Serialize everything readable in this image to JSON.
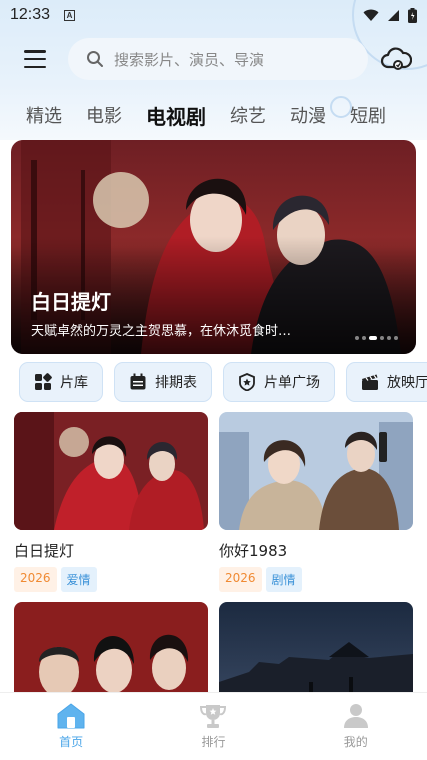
{
  "status": {
    "time": "12:33",
    "notification_glyph": "A"
  },
  "header": {
    "search_placeholder": "搜索影片、演员、导演"
  },
  "tabs": [
    {
      "label": "精选",
      "active": false
    },
    {
      "label": "电影",
      "active": false
    },
    {
      "label": "电视剧",
      "active": true
    },
    {
      "label": "综艺",
      "active": false
    },
    {
      "label": "动漫",
      "active": false
    },
    {
      "label": "短剧",
      "active": false
    }
  ],
  "banner": {
    "title": "白日提灯",
    "description": "天赋卓然的万灵之主贺思慕，在休沐觅食时…",
    "page_count": 6,
    "active_page": 3
  },
  "quick_nav": [
    {
      "label": "片库",
      "icon": "grid-icon"
    },
    {
      "label": "排期表",
      "icon": "calendar-icon"
    },
    {
      "label": "片单广场",
      "icon": "badge-icon"
    },
    {
      "label": "放映厅",
      "icon": "clapperboard-icon"
    }
  ],
  "shows": [
    {
      "title": "白日提灯",
      "year": "2026",
      "genre": "爱情"
    },
    {
      "title": "你好1983",
      "year": "2026",
      "genre": "剧情"
    },
    {
      "title": "",
      "year": "",
      "genre": ""
    },
    {
      "title": "",
      "year": "",
      "genre": ""
    }
  ],
  "bottom_nav": [
    {
      "label": "首页",
      "icon": "home-icon",
      "active": true
    },
    {
      "label": "排行",
      "icon": "trophy-icon",
      "active": false
    },
    {
      "label": "我的",
      "icon": "profile-icon",
      "active": false
    }
  ],
  "colors": {
    "accent": "#4aa5e8",
    "year_tag": "#f08a33",
    "genre_tag": "#3b92d8"
  }
}
